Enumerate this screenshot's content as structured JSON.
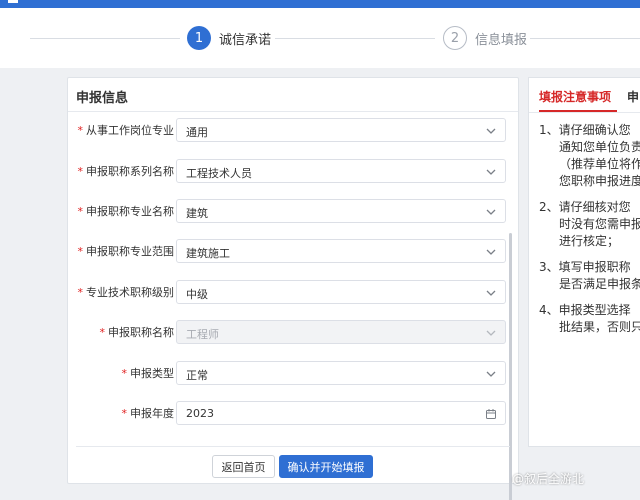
{
  "steps": [
    {
      "number": "1",
      "label": "诚信承诺",
      "state": "active"
    },
    {
      "number": "2",
      "label": "信息填报",
      "state": "inactive"
    }
  ],
  "form": {
    "title": "申报信息",
    "fields": [
      {
        "label": "从事工作岗位专业",
        "required": true,
        "value": "通用",
        "disabled": false,
        "icon": "chevron-down-icon"
      },
      {
        "label": "申报职称系列名称",
        "required": true,
        "value": "工程技术人员",
        "disabled": false,
        "icon": "chevron-down-icon"
      },
      {
        "label": "申报职称专业名称",
        "required": true,
        "value": "建筑",
        "disabled": false,
        "icon": "chevron-down-icon"
      },
      {
        "label": "申报职称专业范围",
        "required": true,
        "value": "建筑施工",
        "disabled": false,
        "icon": "chevron-down-icon"
      },
      {
        "label": "专业技术职称级别",
        "required": true,
        "value": "中级",
        "disabled": false,
        "icon": "chevron-down-icon"
      },
      {
        "label": "申报职称名称",
        "required": true,
        "value": "工程师",
        "disabled": true,
        "icon": "chevron-down-icon"
      },
      {
        "label": "申报类型",
        "required": true,
        "value": "正常",
        "disabled": false,
        "icon": "chevron-down-icon"
      },
      {
        "label": "申报年度",
        "required": true,
        "value": "2023",
        "disabled": false,
        "icon": "calendar-icon"
      }
    ],
    "buttons": {
      "back": "返回首页",
      "confirm": "确认并开始填报"
    }
  },
  "notice": {
    "tab_active": "填报注意事项",
    "tab_other": "申",
    "items": [
      {
        "lines": [
          "1、请仔细确认您",
          "通知您单位负责",
          "（推荐单位将作",
          "您职称申报进度"
        ]
      },
      {
        "lines": [
          "2、请仔细核对您",
          "时没有您需申报",
          "进行核定；"
        ]
      },
      {
        "lines": [
          "3、填写申报职称",
          "是否满足申报条"
        ]
      },
      {
        "lines": [
          "4、申报类型选择",
          "批结果，否则只"
        ]
      }
    ]
  },
  "watermark": "@叙后全游北",
  "colors": {
    "primary": "#2f6fd3",
    "required": "#e02020",
    "notice_tab": "#d62828"
  }
}
